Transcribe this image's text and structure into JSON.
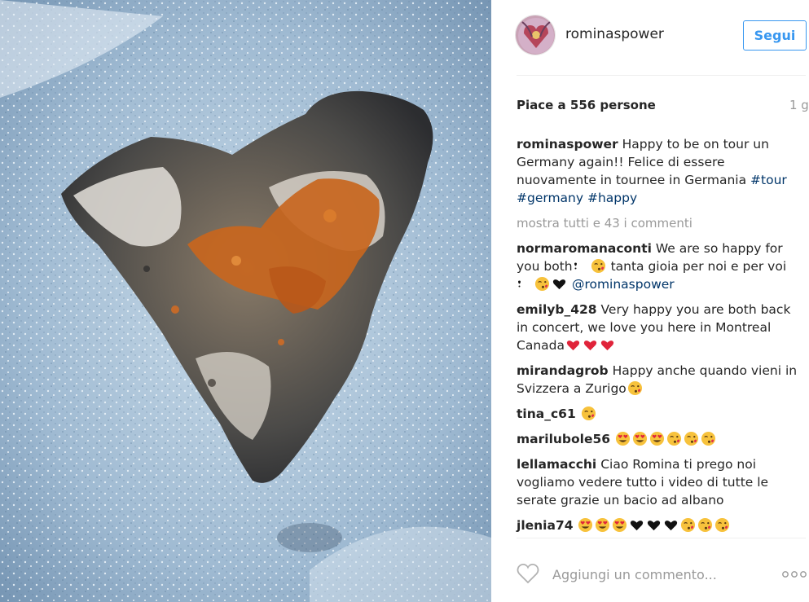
{
  "post": {
    "username": "rominaspower",
    "follow_label": "Segui",
    "likes": "Piace a 556 persone",
    "age": "1 g",
    "caption_user": "rominaspower",
    "caption_text": "Happy to be on tour un Germany again!! Felice di essere nuovamente in tournee in Germania",
    "hashtags": [
      "#tour",
      "#germany",
      "#happy"
    ],
    "show_all_comments": "mostra tutti e 43 i commenti",
    "comment_placeholder": "Aggiungi un commento...",
    "more_options_icon": "ellipsis-icon",
    "like_icon": "heart-outline-icon"
  },
  "comments": [
    {
      "user": "normaromanaconti",
      "text1": "We are so happy for you both",
      "text2": " tanta gioia per noi e per voi",
      "mention": "@rominaspower"
    },
    {
      "user": "emilyb_428",
      "text": "Very happy you are both back in concert, we love you here in Montreal Canada"
    },
    {
      "user": "mirandagrob",
      "text": "Happy anche quando vieni in Svizzera a Zurigo"
    },
    {
      "user": "tina_c61",
      "text": ""
    },
    {
      "user": "marilubole56",
      "text": ""
    },
    {
      "user": "lellamacchi",
      "text": "Ciao Romina ti prego noi vogliamo vedere tutto i video di tutte le serate grazie un bacio ad albano"
    },
    {
      "user": "jlenia74",
      "text": ""
    }
  ],
  "colors": {
    "link": "#003569",
    "accent": "#3897f0",
    "muted": "#999999",
    "snow": "#a9c3da",
    "rock_orange": "#c8661e"
  }
}
